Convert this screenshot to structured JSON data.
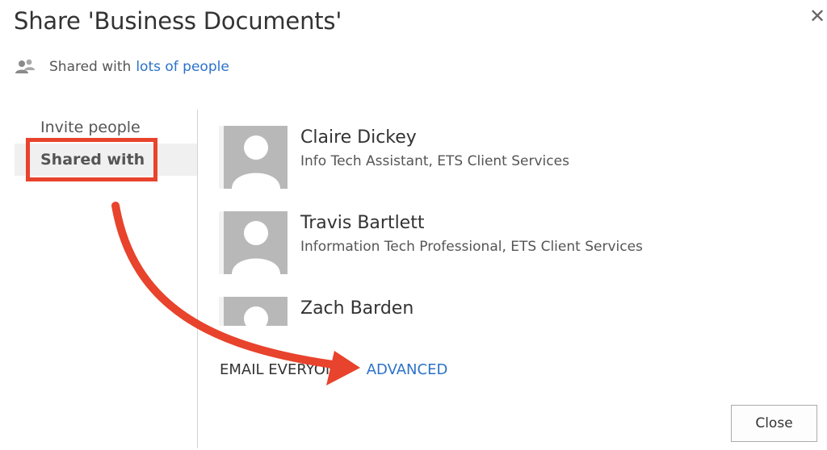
{
  "dialog": {
    "title": "Share 'Business Documents'",
    "close_glyph": "✕"
  },
  "summary": {
    "prefix": "Shared with",
    "link": "lots of people"
  },
  "nav": {
    "items": [
      {
        "label": "Invite people",
        "selected": false
      },
      {
        "label": "Shared with",
        "selected": true
      }
    ]
  },
  "people": [
    {
      "name": "Claire Dickey",
      "title": "Info Tech Assistant, ETS Client Services"
    },
    {
      "name": "Travis Bartlett",
      "title": "Information Tech Professional, ETS Client Services"
    },
    {
      "name": "Zach Barden",
      "title": ""
    }
  ],
  "actions": {
    "email_everyone": "Email everyone",
    "advanced": "Advanced"
  },
  "footer": {
    "close_label": "Close"
  },
  "icons": {
    "people": "people-icon",
    "close": "close-icon",
    "avatar": "person-placeholder-icon"
  },
  "colors": {
    "link": "#2b72c9",
    "annotation": "#e8432c",
    "avatar_bg": "#b8b8b8"
  }
}
